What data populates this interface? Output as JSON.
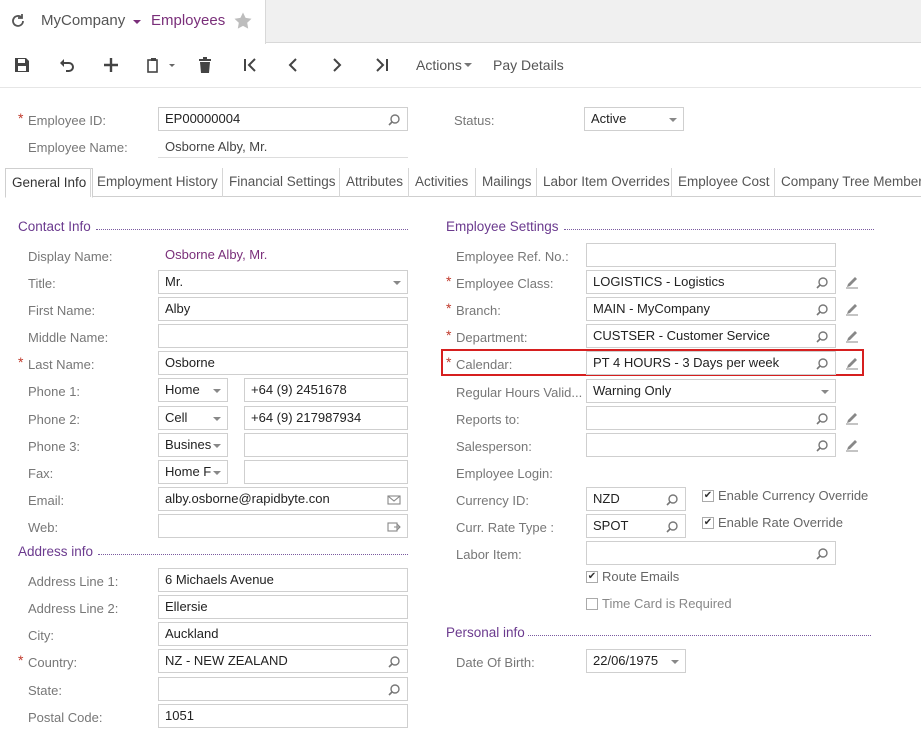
{
  "header": {
    "company": "MyCompany",
    "screen": "Employees"
  },
  "toolbar": {
    "actions_label": "Actions",
    "pay_details_label": "Pay Details"
  },
  "summary": {
    "employee_id_label": "Employee ID:",
    "employee_id_value": "EP00000004",
    "employee_name_label": "Employee Name:",
    "employee_name_value": "Osborne Alby, Mr.",
    "status_label": "Status:",
    "status_value": "Active"
  },
  "tabs": [
    {
      "label": "General Info",
      "active": true
    },
    {
      "label": "Employment History"
    },
    {
      "label": "Financial Settings"
    },
    {
      "label": "Attributes"
    },
    {
      "label": "Activities"
    },
    {
      "label": "Mailings"
    },
    {
      "label": "Labor Item Overrides"
    },
    {
      "label": "Employee Cost"
    },
    {
      "label": "Company Tree Member"
    }
  ],
  "contact": {
    "section_title": "Contact Info",
    "display_name_label": "Display Name:",
    "display_name_value": "Osborne Alby, Mr.",
    "title_label": "Title:",
    "title_value": "Mr.",
    "first_name_label": "First Name:",
    "first_name_value": "Alby",
    "middle_name_label": "Middle Name:",
    "middle_name_value": "",
    "last_name_label": "Last Name:",
    "last_name_value": "Osborne",
    "phone1_label": "Phone 1:",
    "phone1_type": "Home",
    "phone1_value": "+64 (9) 2451678",
    "phone2_label": "Phone 2:",
    "phone2_type": "Cell",
    "phone2_value": "+64 (9) 217987934",
    "phone3_label": "Phone 3:",
    "phone3_type": "Busines",
    "phone3_value": "",
    "fax_label": "Fax:",
    "fax_type": "Home F",
    "fax_value": "",
    "email_label": "Email:",
    "email_value": "alby.osborne@rapidbyte.con",
    "web_label": "Web:",
    "web_value": ""
  },
  "address": {
    "section_title": "Address info",
    "line1_label": "Address Line 1:",
    "line1_value": "6 Michaels Avenue",
    "line2_label": "Address Line 2:",
    "line2_value": "Ellersie",
    "city_label": "City:",
    "city_value": "Auckland",
    "country_label": "Country:",
    "country_value": "NZ - NEW ZEALAND",
    "state_label": "State:",
    "state_value": "",
    "postal_label": "Postal Code:",
    "postal_value": "1051"
  },
  "employee_settings": {
    "section_title": "Employee Settings",
    "ref_no_label": "Employee Ref. No.:",
    "ref_no_value": "",
    "class_label": "Employee Class:",
    "class_value": "LOGISTICS - Logistics",
    "branch_label": "Branch:",
    "branch_value": "MAIN - MyCompany",
    "department_label": "Department:",
    "department_value": "CUSTSER - Customer Service",
    "calendar_label": "Calendar:",
    "calendar_value": "PT 4 HOURS - 3 Days per week",
    "reg_hours_label": "Regular Hours Valid...",
    "reg_hours_value": "Warning Only",
    "reports_to_label": "Reports to:",
    "reports_to_value": "",
    "salesperson_label": "Salesperson:",
    "salesperson_value": "",
    "login_label": "Employee Login:",
    "currency_label": "Currency ID:",
    "currency_value": "NZD",
    "enable_currency_override_label": "Enable Currency Override",
    "enable_currency_override_checked": true,
    "rate_type_label": "Curr. Rate Type :",
    "rate_type_value": "SPOT",
    "enable_rate_override_label": "Enable Rate Override",
    "enable_rate_override_checked": true,
    "labor_item_label": "Labor Item:",
    "labor_item_value": "",
    "route_emails_label": "Route Emails",
    "route_emails_checked": true,
    "time_card_label": "Time Card is Required",
    "time_card_checked": false
  },
  "personal": {
    "section_title": "Personal info",
    "dob_label": "Date Of Birth:",
    "dob_value": "22/06/1975"
  },
  "colors": {
    "accent_purple": "#7a2f7a",
    "required_red": "#c0392b",
    "highlight_red": "#d61f1f"
  }
}
